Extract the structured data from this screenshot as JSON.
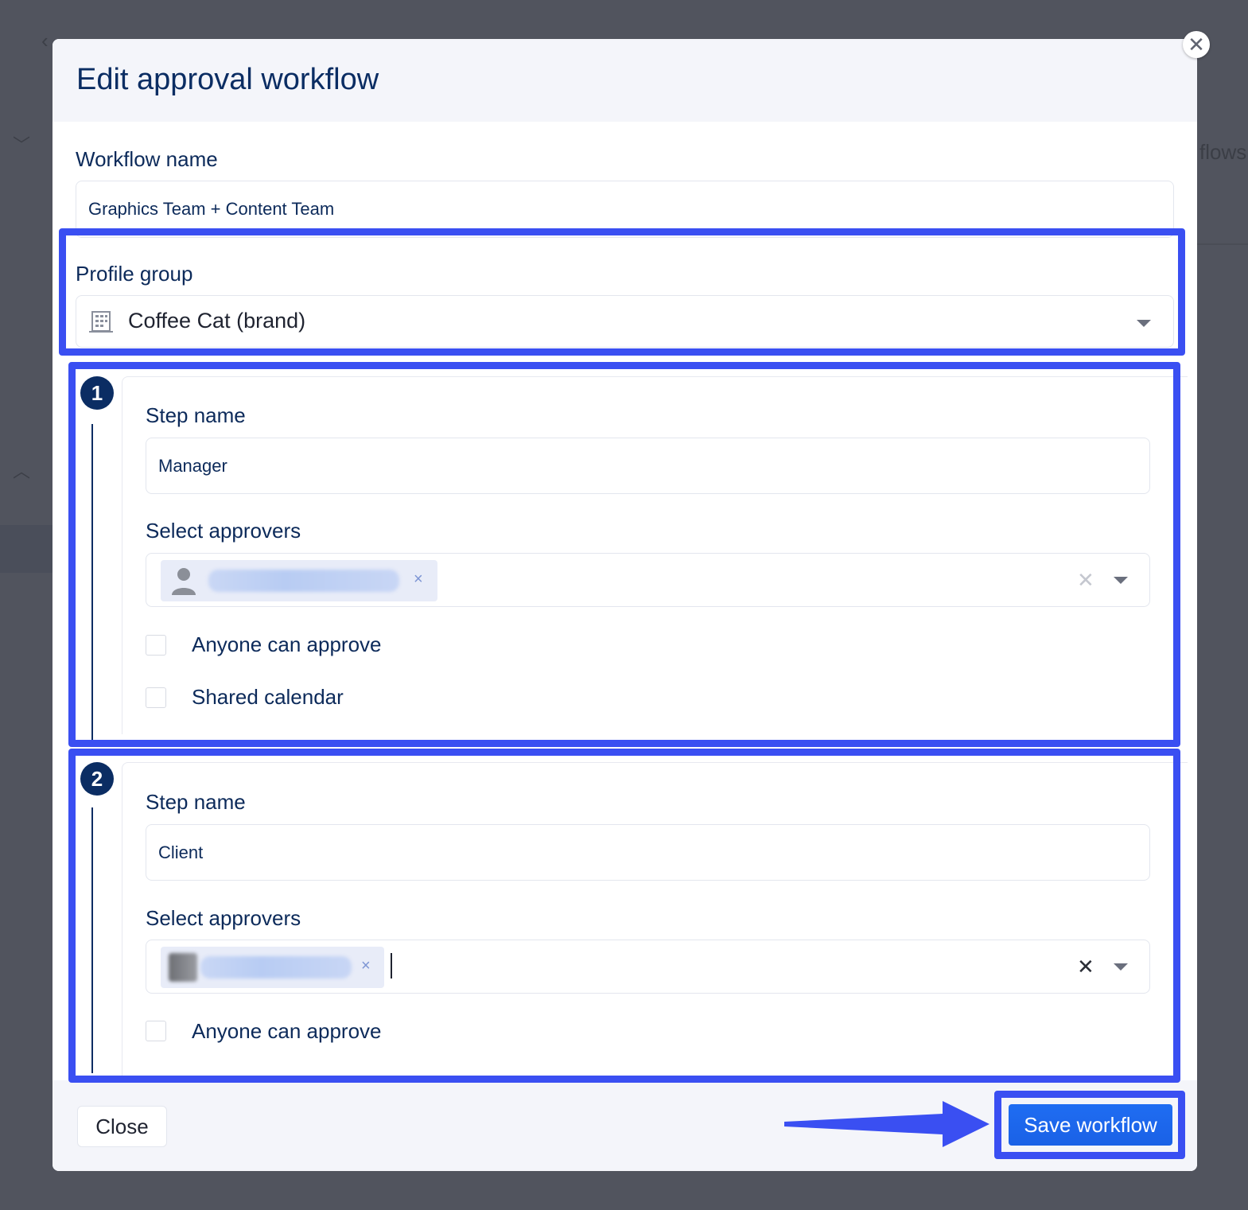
{
  "background": {
    "partial_text": "flows"
  },
  "modal": {
    "title": "Edit approval workflow",
    "close_icon": "close-icon"
  },
  "workflow_name": {
    "label": "Workflow name",
    "value": "Graphics Team + Content Team"
  },
  "profile_group": {
    "label": "Profile group",
    "icon": "building-icon",
    "value": "Coffee Cat (brand)"
  },
  "steps": [
    {
      "number": "1",
      "step_name_label": "Step name",
      "step_name_value": "Manager",
      "approvers_label": "Select approvers",
      "checkboxes": [
        "Anyone can approve",
        "Shared calendar"
      ]
    },
    {
      "number": "2",
      "step_name_label": "Step name",
      "step_name_value": "Client",
      "approvers_label": "Select approvers",
      "checkboxes": [
        "Anyone can approve"
      ]
    }
  ],
  "footer": {
    "close_label": "Close",
    "save_label": "Save workflow"
  },
  "colors": {
    "highlight": "#3a4ff2",
    "primary_button": "#1f6df2",
    "title_text": "#0b2d63",
    "overlay": "#51545e"
  }
}
